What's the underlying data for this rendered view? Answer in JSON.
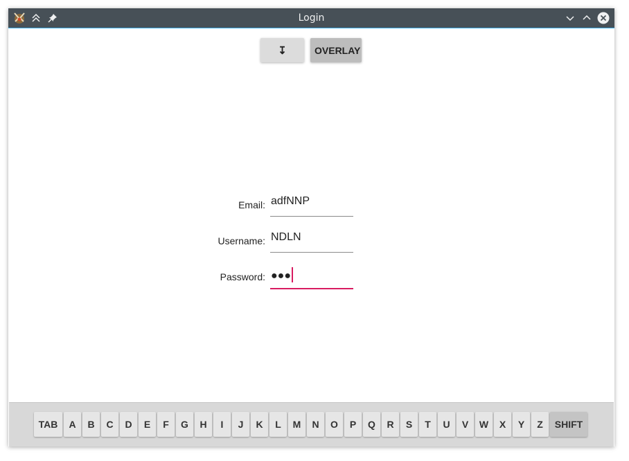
{
  "window": {
    "title": "Login",
    "app_icon": "kde-app-icon",
    "titlebar_left_buttons": [
      "keep-above-icon",
      "pin-icon"
    ],
    "titlebar_right_buttons": [
      "minimize-icon",
      "maximize-icon",
      "close-icon"
    ],
    "accent": "#3daee9",
    "titlebar_color": "#475057"
  },
  "toolbar": {
    "arrow_label": "↧",
    "overlay_label": "OVERLAY"
  },
  "form": {
    "email": {
      "label": "Email:",
      "value": "adfNNP"
    },
    "username": {
      "label": "Username:",
      "value": "NDLN"
    },
    "password": {
      "label": "Password:",
      "value": "●●●",
      "focused": true
    },
    "focus_color": "#d81b60"
  },
  "keyboard": {
    "keys": [
      "TAB",
      "A",
      "B",
      "C",
      "D",
      "E",
      "F",
      "G",
      "H",
      "I",
      "J",
      "K",
      "L",
      "M",
      "N",
      "O",
      "P",
      "Q",
      "R",
      "S",
      "T",
      "U",
      "V",
      "W",
      "X",
      "Y",
      "Z",
      "SHIFT"
    ]
  }
}
